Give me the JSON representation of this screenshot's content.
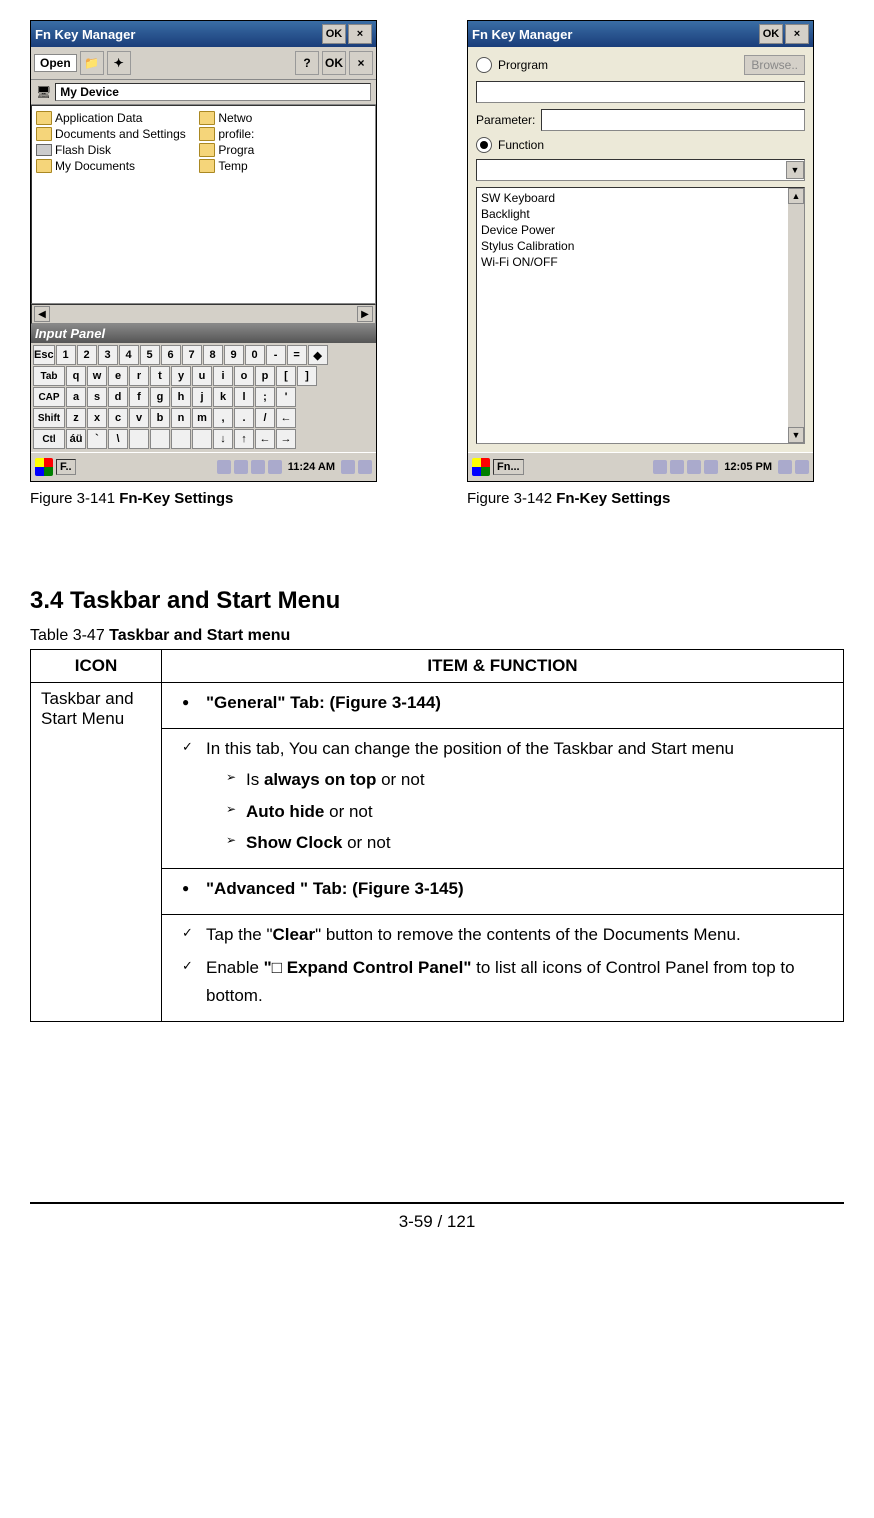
{
  "screenshot_left": {
    "title": "Fn Key Manager",
    "ok": "OK",
    "close": "×",
    "toolbar": {
      "open": "Open",
      "help": "?",
      "ok": "OK",
      "close": "×"
    },
    "location": "My Device",
    "files": {
      "col1": [
        "Application Data",
        "Documents and Settings",
        "Flash Disk",
        "My Documents"
      ],
      "col2": [
        "Netwo",
        "profile:",
        "Progra",
        "Temp"
      ]
    },
    "input_panel": "Input Panel",
    "keyboard": {
      "row1": [
        "Esc",
        "1",
        "2",
        "3",
        "4",
        "5",
        "6",
        "7",
        "8",
        "9",
        "0",
        "-",
        "=",
        "◆"
      ],
      "row2": [
        "Tab",
        "q",
        "w",
        "e",
        "r",
        "t",
        "y",
        "u",
        "i",
        "o",
        "p",
        "[",
        "]"
      ],
      "row3": [
        "CAP",
        "a",
        "s",
        "d",
        "f",
        "g",
        "h",
        "j",
        "k",
        "l",
        ";",
        "'"
      ],
      "row4": [
        "Shift",
        "z",
        "x",
        "c",
        "v",
        "b",
        "n",
        "m",
        ",",
        ".",
        "/",
        "←"
      ],
      "row5": [
        "Ctl",
        "áü",
        "`",
        "\\",
        " ",
        " ",
        " ",
        " ",
        "↓",
        "↑",
        "←",
        "→"
      ]
    },
    "taskbar": {
      "task": "F..",
      "clock": "11:24 AM"
    }
  },
  "screenshot_right": {
    "title": "Fn Key Manager",
    "ok": "OK",
    "close": "×",
    "program_label": "Prorgram",
    "browse": "Browse..",
    "parameter_label": "Parameter:",
    "function_label": "Function",
    "function_list": [
      "SW Keyboard",
      "Backlight",
      "Device Power",
      "Stylus Calibration",
      "Wi-Fi ON/OFF"
    ],
    "taskbar": {
      "task": "Fn...",
      "clock": "12:05 PM"
    }
  },
  "captions": {
    "left_prefix": "Figure 3-141 ",
    "left_bold": "Fn-Key Settings",
    "right_prefix": "Figure 3-142 ",
    "right_bold": "Fn-Key Settings"
  },
  "section_heading": "3.4 Taskbar and Start Menu",
  "table_caption_prefix": "Table 3-47 ",
  "table_caption_bold": "Taskbar and Start menu",
  "table": {
    "header_icon": "ICON",
    "header_item": "ITEM & FUNCTION",
    "icon_cell": "Taskbar and Start Menu",
    "general_tab": "\"General\" Tab: (Figure 3-144)",
    "general_intro": "In this tab, You can change the position of the Taskbar and Start menu",
    "general_sub1_pre": "Is ",
    "general_sub1_bold": "always on top",
    "general_sub1_post": " or not",
    "general_sub2_bold": "Auto hide",
    "general_sub2_post": " or not",
    "general_sub3_bold": "Show Clock",
    "general_sub3_post": " or not",
    "advanced_tab": "\"Advanced \" Tab: (Figure 3-145)",
    "advanced_item1_pre": "Tap the \"",
    "advanced_item1_bold": "Clear",
    "advanced_item1_post": "\" button to remove the contents of the Documents Menu.",
    "advanced_item2_pre": "Enable ",
    "advanced_item2_bold": "\"□ Expand Control Panel\"",
    "advanced_item2_post": " to list all icons of Control Panel from top to bottom."
  },
  "page_number": "3-59 / 121"
}
